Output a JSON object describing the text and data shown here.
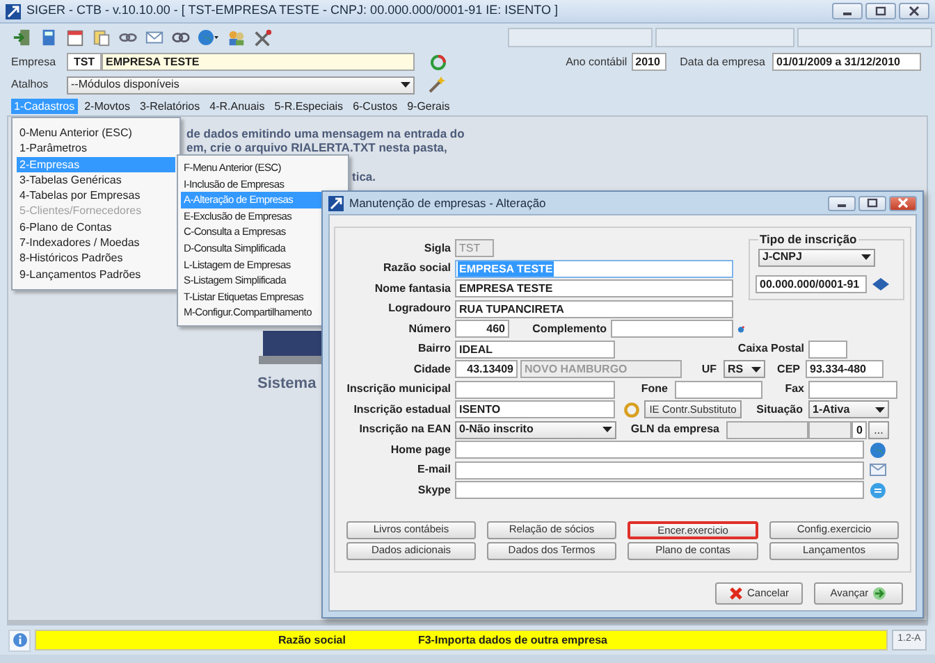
{
  "window": {
    "title": "SIGER - CTB - v.10.10.00 - [ TST-EMPRESA TESTE - CNPJ: 00.000.000/0001-91 IE: ISENTO ]"
  },
  "company_bar": {
    "label": "Empresa",
    "code": "TST",
    "name": "EMPRESA TESTE",
    "year_label": "Ano contábil",
    "year": "2010",
    "date_label": "Data da empresa",
    "date_range": "01/01/2009 a 31/12/2010"
  },
  "shortcuts": {
    "label": "Atalhos",
    "value": "--Módulos disponíveis"
  },
  "menu_bar": [
    {
      "label": "1-Cadastros",
      "selected": true
    },
    {
      "label": "2-Movtos",
      "selected": false
    },
    {
      "label": "3-Relatórios",
      "selected": false
    },
    {
      "label": "4-R.Anuais",
      "selected": false
    },
    {
      "label": "5-R.Especiais",
      "selected": false
    },
    {
      "label": "6-Custos",
      "selected": false
    },
    {
      "label": "9-Gerais",
      "selected": false
    }
  ],
  "menu": [
    {
      "label": "0-Menu Anterior (ESC)",
      "selected": false,
      "disabled": false
    },
    {
      "label": "1-Parâmetros",
      "selected": false,
      "disabled": false
    },
    {
      "label": "2-Empresas",
      "selected": true,
      "disabled": false
    },
    {
      "label": "3-Tabelas Genéricas",
      "selected": false,
      "disabled": false
    },
    {
      "label": "4-Tabelas por Empresas",
      "selected": false,
      "disabled": false
    },
    {
      "label": "5-Clientes/Fornecedores",
      "selected": false,
      "disabled": true
    },
    {
      "label": "6-Plano de Contas",
      "selected": false,
      "disabled": false
    },
    {
      "label": "7-Indexadores / Moedas",
      "selected": false,
      "disabled": false
    },
    {
      "label": "8-Históricos Padrões",
      "selected": false,
      "disabled": false
    },
    {
      "label": "9-Lançamentos Padrões",
      "selected": false,
      "disabled": false
    }
  ],
  "submenu": [
    {
      "label": "F-Menu Anterior (ESC)",
      "selected": false
    },
    {
      "label": "I-Inclusão de Empresas",
      "selected": false
    },
    {
      "label": "A-Alteração de Empresas",
      "selected": true
    },
    {
      "label": "E-Exclusão de Empresas",
      "selected": false
    },
    {
      "label": "C-Consulta a Empresas",
      "selected": false
    },
    {
      "label": "D-Consulta Simplificada",
      "selected": false
    },
    {
      "label": "L-Listagem de Empresas",
      "selected": false
    },
    {
      "label": "S-Listagem Simplificada",
      "selected": false
    },
    {
      "label": "T-Listar Etiquetas Empresas",
      "selected": false
    },
    {
      "label": "M-Configur.Compartilhamento",
      "selected": false
    }
  ],
  "background_message": [
    "de dados emitindo uma mensagem na entrada do",
    "em, crie o arquivo RIALERTA.TXT nesta pasta,",
    "tica."
  ],
  "logo_caption": "Sistema",
  "dialog": {
    "title": "Manutenção de empresas - Alteração",
    "sigla": {
      "label": "Sigla",
      "value": "TST",
      "disabled": true
    },
    "razao_social": {
      "label": "Razão social",
      "value": "EMPRESA TESTE",
      "text_selected": true
    },
    "nome_fantasia": {
      "label": "Nome fantasia",
      "value": "EMPRESA TESTE"
    },
    "logradouro": {
      "label": "Logradouro",
      "value": "RUA TUPANCIRETA"
    },
    "numero": {
      "label": "Número",
      "value": "460"
    },
    "complemento": {
      "label": "Complemento"
    },
    "tipo_inscricao": {
      "title": "Tipo de inscrição",
      "type": "J-CNPJ",
      "number": "00.000.000/0001-91"
    },
    "bairro": {
      "label": "Bairro",
      "value": "IDEAL"
    },
    "caixa_postal": {
      "label": "Caixa Postal"
    },
    "cidade": {
      "label": "Cidade",
      "code": "43.13409",
      "name": "NOVO HAMBURGO",
      "name_disabled": true
    },
    "uf": {
      "label": "UF",
      "value": "RS"
    },
    "cep": {
      "label": "CEP",
      "value": "93.334-480"
    },
    "inscricao_municipal": {
      "label": "Inscrição municipal"
    },
    "fone": {
      "label": "Fone"
    },
    "fax": {
      "label": "Fax"
    },
    "inscricao_estadual": {
      "label": "Inscrição estadual",
      "value": "ISENTO"
    },
    "ie_button": "IE Contr.Substituto",
    "situacao": {
      "label": "Situação",
      "value": "1-Ativa"
    },
    "ean": {
      "label": "Inscrição na EAN",
      "value": "0-Não inscrito"
    },
    "gln": {
      "label": "GLN da empresa",
      "check_digit": "0",
      "button": "..."
    },
    "home_page": {
      "label": "Home page"
    },
    "email": {
      "label": "E-mail"
    },
    "skype": {
      "label": "Skype"
    },
    "actions": [
      {
        "label": "Livros contábeis",
        "focused": false
      },
      {
        "label": "Relação de sócios",
        "focused": false
      },
      {
        "label": "Encer.exercicio",
        "focused": true
      },
      {
        "label": "Config.exercicio",
        "focused": false
      },
      {
        "label": "Dados adicionais",
        "focused": false
      },
      {
        "label": "Dados dos Termos",
        "focused": false
      },
      {
        "label": "Plano de contas",
        "focused": false
      },
      {
        "label": "Lançamentos",
        "focused": false
      }
    ],
    "cancel": "Cancelar",
    "next": "Avançar"
  },
  "status_bar": {
    "field": "Razão social",
    "hint": "F3-Importa dados de outra empresa",
    "version": "1.2-A"
  }
}
